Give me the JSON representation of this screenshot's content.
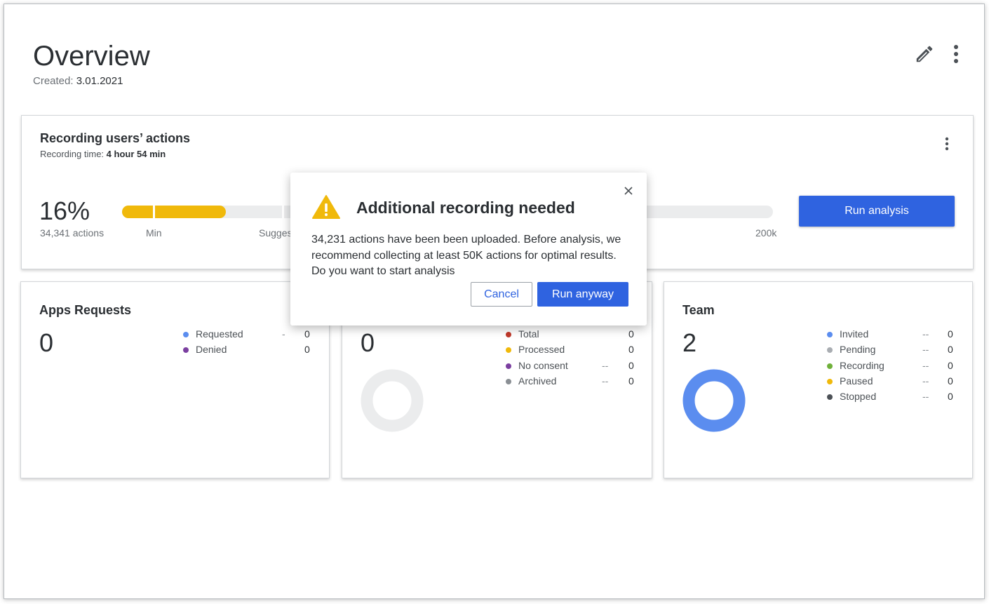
{
  "header": {
    "title": "Overview",
    "created_label": "Created:",
    "created_date": "3.01.2021",
    "edit_icon": "pencil-icon",
    "menu_icon": "more-vertical-icon"
  },
  "recording": {
    "title": "Recording users’ actions",
    "time_label": "Recording time:",
    "time_value": "4 hour 54 min",
    "percent": "16%",
    "progress_fraction": 0.16,
    "actions": "34,341 actions",
    "labels": {
      "min": "Min",
      "suggested": "Sugges",
      "max": "200k"
    },
    "run_label": "Run analysis",
    "bar_color": "#f0b90b"
  },
  "apps": {
    "title": "Apps Requests",
    "count": "0",
    "legend": [
      {
        "label": "Requested",
        "color": "#5b8def",
        "dash": "-",
        "value": "0"
      },
      {
        "label": "Denied",
        "color": "#7b3fa0",
        "dash": "",
        "value": "0"
      }
    ]
  },
  "middle": {
    "count": "0",
    "legend": [
      {
        "label": "Total",
        "color": "#c0392b",
        "dash": "",
        "value": "0"
      },
      {
        "label": "Processed",
        "color": "#f0b90b",
        "dash": "",
        "value": "0"
      },
      {
        "label": "No consent",
        "color": "#7b3fa0",
        "dash": "--",
        "value": "0"
      },
      {
        "label": "Archived",
        "color": "#8a8f94",
        "dash": "--",
        "value": "0"
      }
    ],
    "ring_color": "#ebeced"
  },
  "team": {
    "title": "Team",
    "count": "2",
    "legend": [
      {
        "label": "Invited",
        "color": "#5b8def",
        "dash": "--",
        "value": "0"
      },
      {
        "label": "Pending",
        "color": "#a9adb2",
        "dash": "--",
        "value": "0"
      },
      {
        "label": "Recording",
        "color": "#6fb03a",
        "dash": "--",
        "value": "0"
      },
      {
        "label": "Paused",
        "color": "#f0b90b",
        "dash": "--",
        "value": "0"
      },
      {
        "label": "Stopped",
        "color": "#4c5156",
        "dash": "--",
        "value": "0"
      }
    ],
    "ring_color": "#5b8def"
  },
  "modal": {
    "title": "Additional recording needed",
    "body": "34,231 actions have been been uploaded. Before analysis, we recommend collecting at least 50K actions for optimal results. Do you want to start analysis",
    "cancel_label": "Cancel",
    "confirm_label": "Run anyway",
    "icon": "warning-icon",
    "close_icon": "close-icon"
  }
}
